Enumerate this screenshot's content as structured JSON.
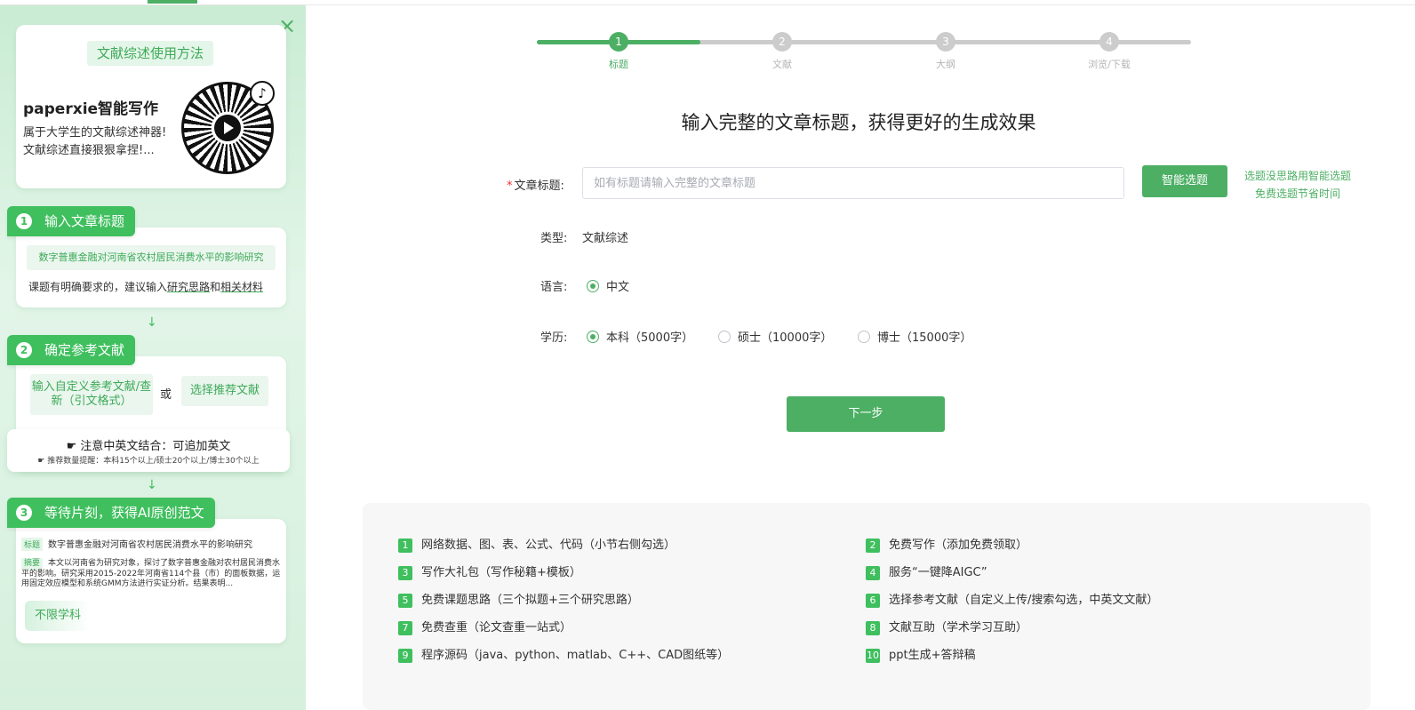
{
  "sidebar": {
    "close_glyph": "×",
    "intro": {
      "pill": "文献综述使用方法",
      "title": "paperxie智能写作",
      "desc_line1": "属于大学生的文献综述神器!",
      "desc_line2": "文献综述直接狠狠拿捏!..."
    },
    "step1": {
      "num": "1",
      "title": "输入文章标题",
      "example": "数字普惠金融对河南省农村居民消费水平的影响研究",
      "note_prefix": "课题有明确要求的，建议输入",
      "note_link1": "研究思路",
      "note_mid": "和",
      "note_link2": "相关材料"
    },
    "step2": {
      "num": "2",
      "title": "确定参考文献",
      "option_a": "输入自定义参考文献/查新（引文格式）",
      "or": "或",
      "option_b": "选择推荐文献",
      "notice_line1": "注意中英文结合：可追加英文",
      "notice_line2": "推荐数量提醒：本科15个以上/硕士20个以上/博士30个以上"
    },
    "step3": {
      "num": "3",
      "title": "等待片刻，获得AI原创范文",
      "title_tag": "标题",
      "title_text": "数字普惠金融对河南省农村居民消费水平的影响研究",
      "abstract_tag": "摘要",
      "abstract_text": "本文以河南省为研究对象，探讨了数字普惠金融对农村居民消费水平的影响。研究采用2015-2022年河南省114个县（市）的面板数据，运用固定效应模型和系统GMM方法进行实证分析。结果表明...",
      "badge": "不限学科"
    }
  },
  "progress": {
    "steps": [
      {
        "num": "1",
        "label": "标题"
      },
      {
        "num": "2",
        "label": "文献"
      },
      {
        "num": "3",
        "label": "大纲"
      },
      {
        "num": "4",
        "label": "浏览/下载"
      }
    ]
  },
  "main": {
    "heading": "输入完整的文章标题，获得更好的生成效果",
    "title_label": "文章标题:",
    "required_mark": "*",
    "title_placeholder": "如有标题请输入完整的文章标题",
    "smart_button": "智能选题",
    "smart_tip_line1": "选题没思路用智能选题",
    "smart_tip_line2": "免费选题节省时间",
    "type_label": "类型:",
    "type_value": "文献综述",
    "lang_label": "语言:",
    "lang_option": "中文",
    "degree_label": "学历:",
    "degree_options": [
      "本科（5000字）",
      "硕士（10000字）",
      "博士（15000字）"
    ],
    "next_button": "下一步"
  },
  "features": [
    {
      "num": "1",
      "text": "网络数据、图、表、公式、代码（小节右侧勾选）"
    },
    {
      "num": "2",
      "text": "免费写作（添加免费领取）"
    },
    {
      "num": "3",
      "text": "写作大礼包（写作秘籍+模板）"
    },
    {
      "num": "4",
      "text": "服务“一键降AIGC”"
    },
    {
      "num": "5",
      "text": "免费课题思路（三个拟题+三个研究思路）"
    },
    {
      "num": "6",
      "text": "选择参考文献（自定义上传/搜索勾选，中英文文献）"
    },
    {
      "num": "7",
      "text": "免费查重（论文查重一站式）"
    },
    {
      "num": "8",
      "text": "文献互助（学术学习互助）"
    },
    {
      "num": "9",
      "text": "程序源码（java、python、matlab、C++、CAD图纸等）"
    },
    {
      "num": "10",
      "text": "ppt生成+答辩稿"
    }
  ],
  "colors": {
    "accent": "#4caf64",
    "inactive": "#cccccc"
  }
}
